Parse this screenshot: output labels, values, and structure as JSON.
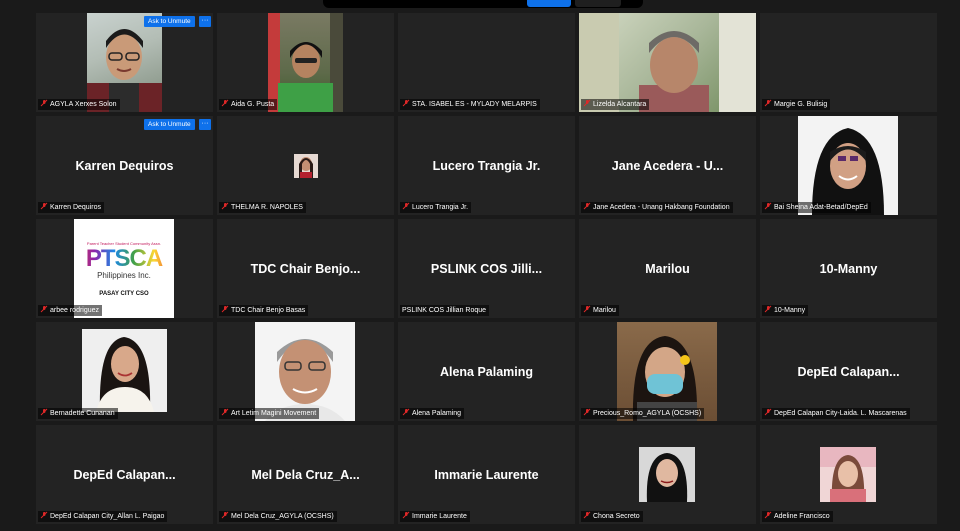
{
  "meeting": {
    "ask_to_unmute": "Ask to Unmute",
    "more_glyph": "···"
  },
  "colors": {
    "accent": "#0e71eb",
    "muted_mic": "#e02828",
    "tile_bg": "#232323",
    "background": "#1a1a1a"
  },
  "participants": [
    {
      "label": "AGYLA Xerxes Solon",
      "muted": true,
      "video": true
    },
    {
      "label": "Aida G. Pusta",
      "muted": true,
      "video": true
    },
    {
      "label": "STA. ISABEL ES - MYLADY MELARPIS",
      "muted": true,
      "video": false
    },
    {
      "label": "Lizelda Alcantara",
      "muted": true,
      "video": true
    },
    {
      "label": "Margie G. Bulisig",
      "muted": true,
      "video": false
    },
    {
      "name": "Karren Dequiros",
      "label": "Karren Dequiros",
      "muted": true
    },
    {
      "label": "THELMA R. NAPOLES",
      "muted": true,
      "video": true
    },
    {
      "name": "Lucero Trangia Jr.",
      "label": "Lucero Trangia Jr.",
      "muted": true
    },
    {
      "name": "Jane Acedera - U...",
      "label": "Jane Acedera - Unang Hakbang Foundation",
      "muted": true
    },
    {
      "label": "Bai Sheina Adat-Betad/DepEd",
      "muted": true,
      "video": true
    },
    {
      "label": "arbee rodriguez",
      "muted": true,
      "video": true
    },
    {
      "name": "TDC Chair Benjo...",
      "label": "TDC Chair Benjo Basas",
      "muted": true
    },
    {
      "name": "PSLINK COS Jilli...",
      "label": "PSLINK COS Jillian Roque",
      "muted": false
    },
    {
      "name": "Marilou",
      "label": "Marilou",
      "muted": true
    },
    {
      "name": "10-Manny",
      "label": "10-Manny",
      "muted": true
    },
    {
      "label": "Bernadette Cunanan",
      "muted": true,
      "video": true
    },
    {
      "label": "Art Letim  Magini Movement",
      "muted": true,
      "video": true
    },
    {
      "name": "Alena Palaming",
      "label": "Alena Palaming",
      "muted": true
    },
    {
      "label": "Precious_Romo_AGYLA (OCSHS)",
      "muted": true,
      "video": true
    },
    {
      "name": "DepEd Calapan...",
      "label": "DepEd Calapan City-Laida. L. Mascarenas",
      "muted": true
    },
    {
      "name": "DepEd Calapan...",
      "label": "DepEd Calapan City_Allan L. Paigao",
      "muted": true
    },
    {
      "name": "Mel Dela Cruz_A...",
      "label": "Mel Dela Cruz_AGYLA (OCSHS)",
      "muted": true
    },
    {
      "name": "Immarie Laurente",
      "label": "Immarie Laurente",
      "muted": true
    },
    {
      "label": "Chona Secreto",
      "muted": true,
      "video": true
    },
    {
      "label": "Adeline Francisco",
      "muted": true,
      "video": true
    }
  ],
  "ptsca_logo": {
    "top": "Parent Teacher Student Community Assn.",
    "main": "PTSCA",
    "sub": "Philippines Inc.",
    "bottom": "PASAY CITY CSO"
  }
}
